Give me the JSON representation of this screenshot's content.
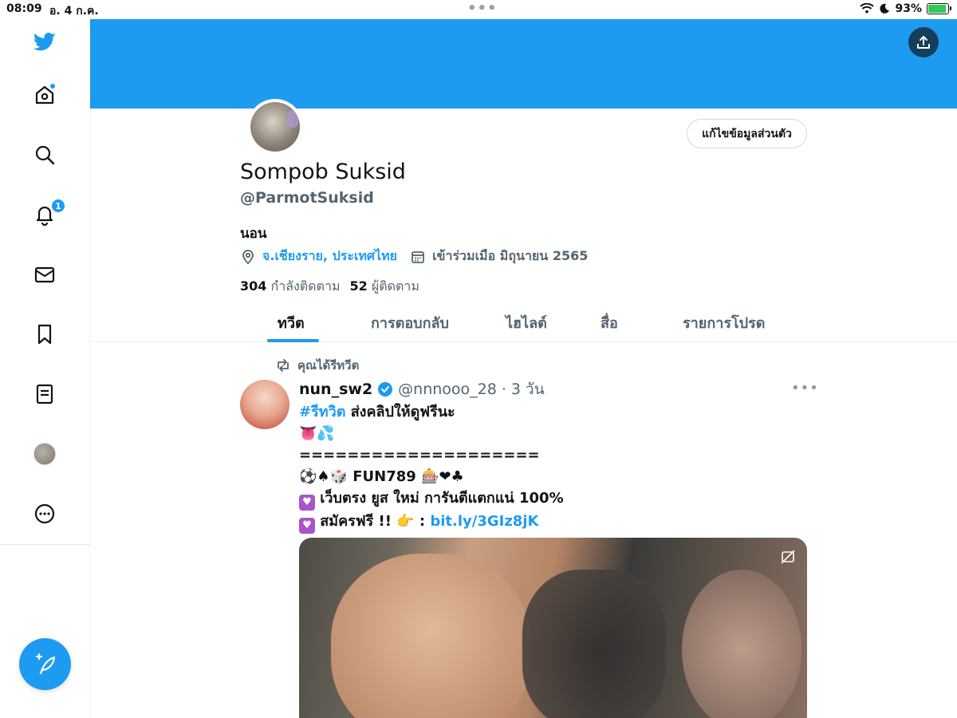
{
  "status_bar": {
    "time": "08:09",
    "date": "อ. 4 ก.ค.",
    "battery_percent": "93%",
    "battery_level": 0.93
  },
  "sidebar": {
    "items": [
      {
        "name": "home",
        "icon": "home-icon",
        "has_dot": true
      },
      {
        "name": "explore",
        "icon": "search-icon"
      },
      {
        "name": "notifications",
        "icon": "bell-icon",
        "badge": "1"
      },
      {
        "name": "messages",
        "icon": "mail-icon"
      },
      {
        "name": "bookmarks",
        "icon": "bookmark-icon"
      },
      {
        "name": "lists",
        "icon": "list-icon"
      },
      {
        "name": "profile",
        "icon": "avatar"
      },
      {
        "name": "more",
        "icon": "more-icon"
      }
    ],
    "compose_icon": "feather-plus-icon"
  },
  "colors": {
    "accent": "#1d9bf0",
    "banner": "#1d9bf0",
    "text_primary": "#0f1419",
    "text_secondary": "#536471"
  },
  "profile": {
    "edit_label": "แก้ไขข้อมูลส่วนตัว",
    "display_name": "Sompob Suksid",
    "handle": "@ParmotSuksid",
    "bio": "นอน",
    "location": "จ.เชียงราย, ประเทศไทย",
    "joined": "เข้าร่วมเมือ มิถุนายน 2565",
    "following_count": "304",
    "following_label": "กำลังติดตาม",
    "followers_count": "52",
    "followers_label": "ผู้ติดตาม"
  },
  "tabs": [
    {
      "label": "ทวีต",
      "active": true
    },
    {
      "label": "การตอบกลับ"
    },
    {
      "label": "ไฮไลต์"
    },
    {
      "label": "สื่อ"
    },
    {
      "label": "รายการโปรด"
    }
  ],
  "tweet": {
    "retweet_label": "คุณได้รีทวีต",
    "author_name": "nun_sw2",
    "author_handle": "@nnnooo_28",
    "time_sep": "·",
    "time": "3 วัน",
    "verified": true,
    "hashtag": "#รีทวิต",
    "line1_rest": " ส่งคลิปให้ดูฟรีนะ",
    "line2": "👅💦",
    "line3": "====================",
    "line4": "⚽♠🎲 FUN789 🎰❤♣",
    "line5": "เว็บตรง ยูส ใหม่ การันตีแตกแน่ 100%",
    "line6_prefix": "สมัครฟรี !! 👉 : ",
    "link": "bit.ly/3GIz8jK",
    "heart_glyph": "♥"
  }
}
